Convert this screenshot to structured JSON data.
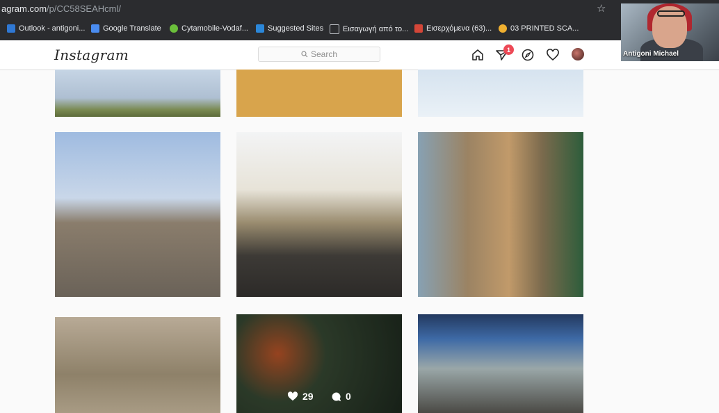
{
  "browser": {
    "url_host": "agram.com",
    "url_path": "/p/CC58SEAHcml/",
    "bookmarks": [
      {
        "label": "Outlook - antigoni...",
        "icon": "outlook-icon",
        "color": "#2f78d4"
      },
      {
        "label": "Google Translate",
        "icon": "translate-icon",
        "color": "#4a8cf0"
      },
      {
        "label": "Cytamobile-Vodaf...",
        "icon": "cytamobile-icon",
        "color": "#6bbf3b"
      },
      {
        "label": "Suggested Sites",
        "icon": "bing-icon",
        "color": "#2b87d9"
      },
      {
        "label": "Εισαγωγή από το...",
        "icon": "folder-icon",
        "color": "#bdc1c6"
      },
      {
        "label": "Εισερχόμενα (63)...",
        "icon": "gmail-icon",
        "color": "#d44638"
      },
      {
        "label": "03 PRINTED SCA...",
        "icon": "circle-icon",
        "color": "#f0b030"
      }
    ]
  },
  "instagram": {
    "logo": "Instagram",
    "search_placeholder": "Search",
    "notification_count": "1",
    "grid": [
      {
        "id": "post-1"
      },
      {
        "id": "post-2"
      },
      {
        "id": "post-3"
      },
      {
        "id": "post-4"
      },
      {
        "id": "post-5"
      },
      {
        "id": "post-6"
      },
      {
        "id": "post-7"
      },
      {
        "id": "post-8"
      },
      {
        "id": "post-9"
      }
    ],
    "hovered_post": {
      "likes": "29",
      "comments": "0"
    }
  },
  "video_call": {
    "participant_name": "Antigoni Michael"
  },
  "colors": {
    "chrome": "#2b2c2f",
    "ig_background": "#fafafa",
    "badge": "#ed4956"
  }
}
